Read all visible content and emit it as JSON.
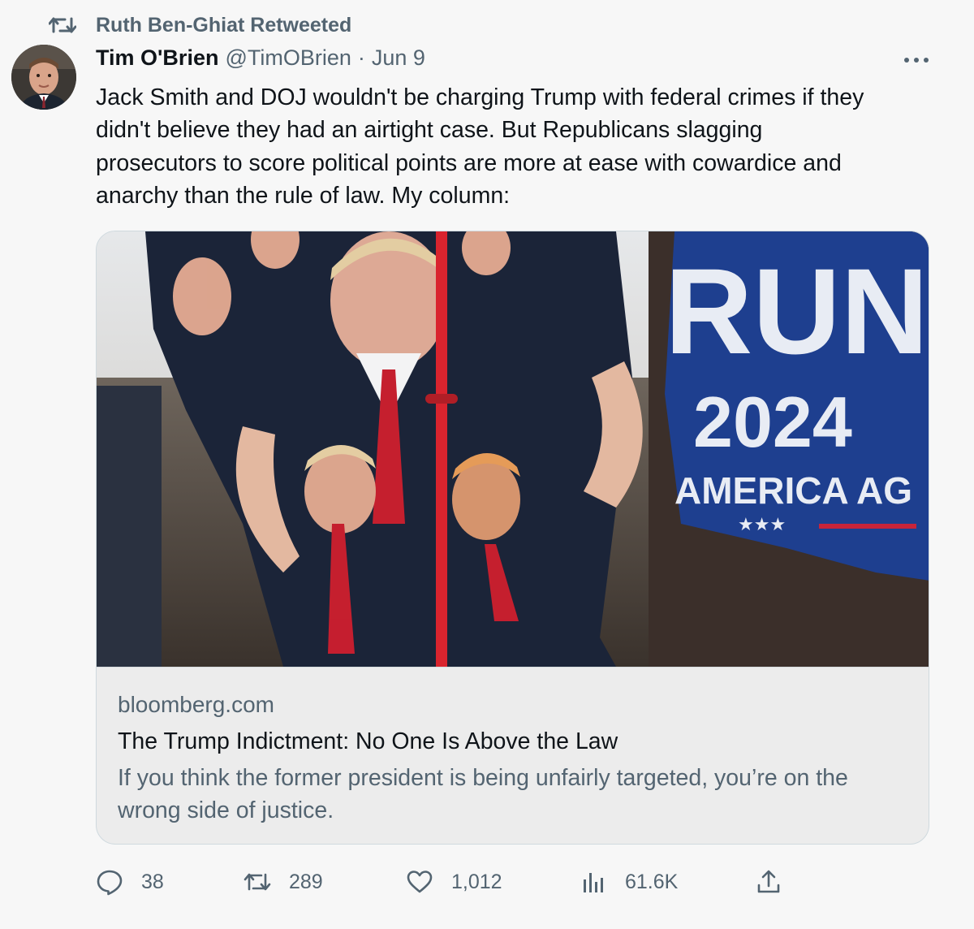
{
  "retweet_banner": {
    "label": "Ruth Ben-Ghiat Retweeted",
    "icon": "retweet-icon"
  },
  "tweet": {
    "author_name": "Tim O'Brien",
    "author_handle": "@TimOBrien",
    "separator": "·",
    "date": "Jun 9",
    "more_icon": "more-icon",
    "text": "Jack Smith and DOJ wouldn't be charging Trump with federal crimes if they\ndidn't believe they had an airtight case. But Republicans slagging\nprosecutors to score political points are more at ease with cowardice and\nanarchy than the rule of law. My column:"
  },
  "card": {
    "image_overlay_text": {
      "flag_top": "RUN",
      "flag_year": "2024",
      "flag_bottom": "AMERICA AG"
    },
    "domain": "bloomberg.com",
    "title": "The Trump Indictment: No One Is Above the Law",
    "description": "If you think the former president is being unfairly targeted, you’re on the wrong side of justice."
  },
  "actions": {
    "reply": {
      "icon": "reply-icon",
      "count": "38"
    },
    "retweet": {
      "icon": "retweet-icon",
      "count": "289"
    },
    "like": {
      "icon": "heart-icon",
      "count": "1,012"
    },
    "views": {
      "icon": "views-icon",
      "count": "61.6K"
    },
    "share": {
      "icon": "share-icon"
    }
  },
  "colors": {
    "secondary_text": "#536471",
    "primary_text": "#0f1419",
    "background": "#f7f7f7",
    "border": "#cfd9de"
  }
}
